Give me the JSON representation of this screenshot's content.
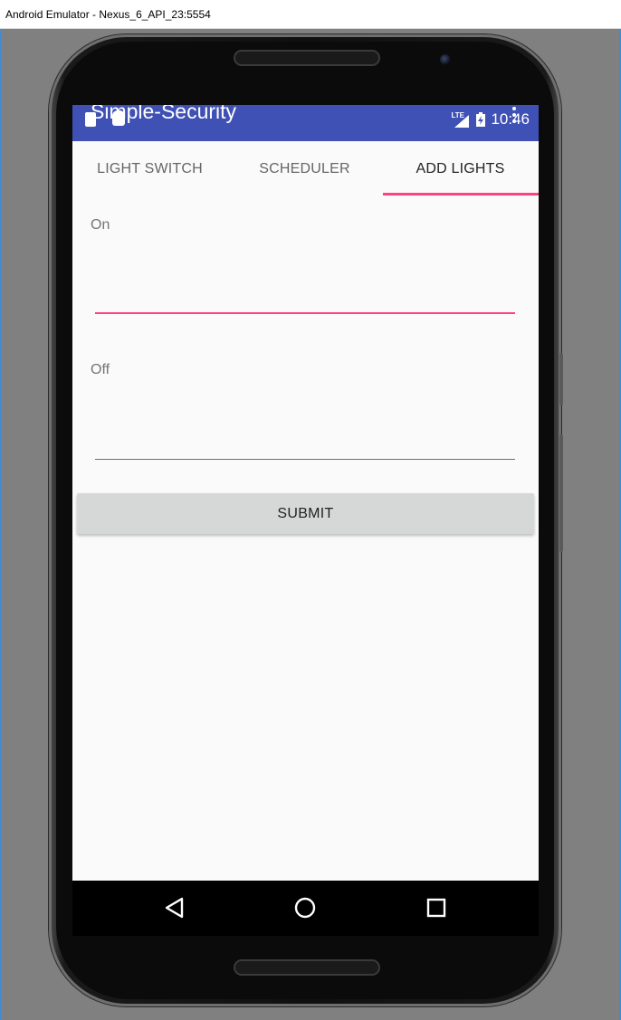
{
  "window": {
    "title": "Android Emulator - Nexus_6_API_23:5554"
  },
  "status_bar": {
    "network_label": "LTE",
    "time": "10:46",
    "icons": [
      "notification-icon",
      "android-icon",
      "lte-signal-icon",
      "battery-icon",
      "overflow-menu-icon"
    ]
  },
  "app_bar": {
    "title": "Simple-Security",
    "color": "#3f51b5"
  },
  "tabs": [
    {
      "label": "LIGHT SWITCH",
      "selected": false
    },
    {
      "label": "SCHEDULER",
      "selected": false
    },
    {
      "label": "ADD LIGHTS",
      "selected": true
    }
  ],
  "form": {
    "on_label": "On",
    "on_value": "",
    "off_label": "Off",
    "off_value": "",
    "submit_label": "SUBMIT"
  },
  "nav_bar": {
    "icons": [
      "back-icon",
      "home-icon",
      "recents-icon"
    ]
  },
  "colors": {
    "accent": "#ff4081",
    "primary": "#3f51b5",
    "background": "#fafafa",
    "button": "#d6d7d7"
  }
}
